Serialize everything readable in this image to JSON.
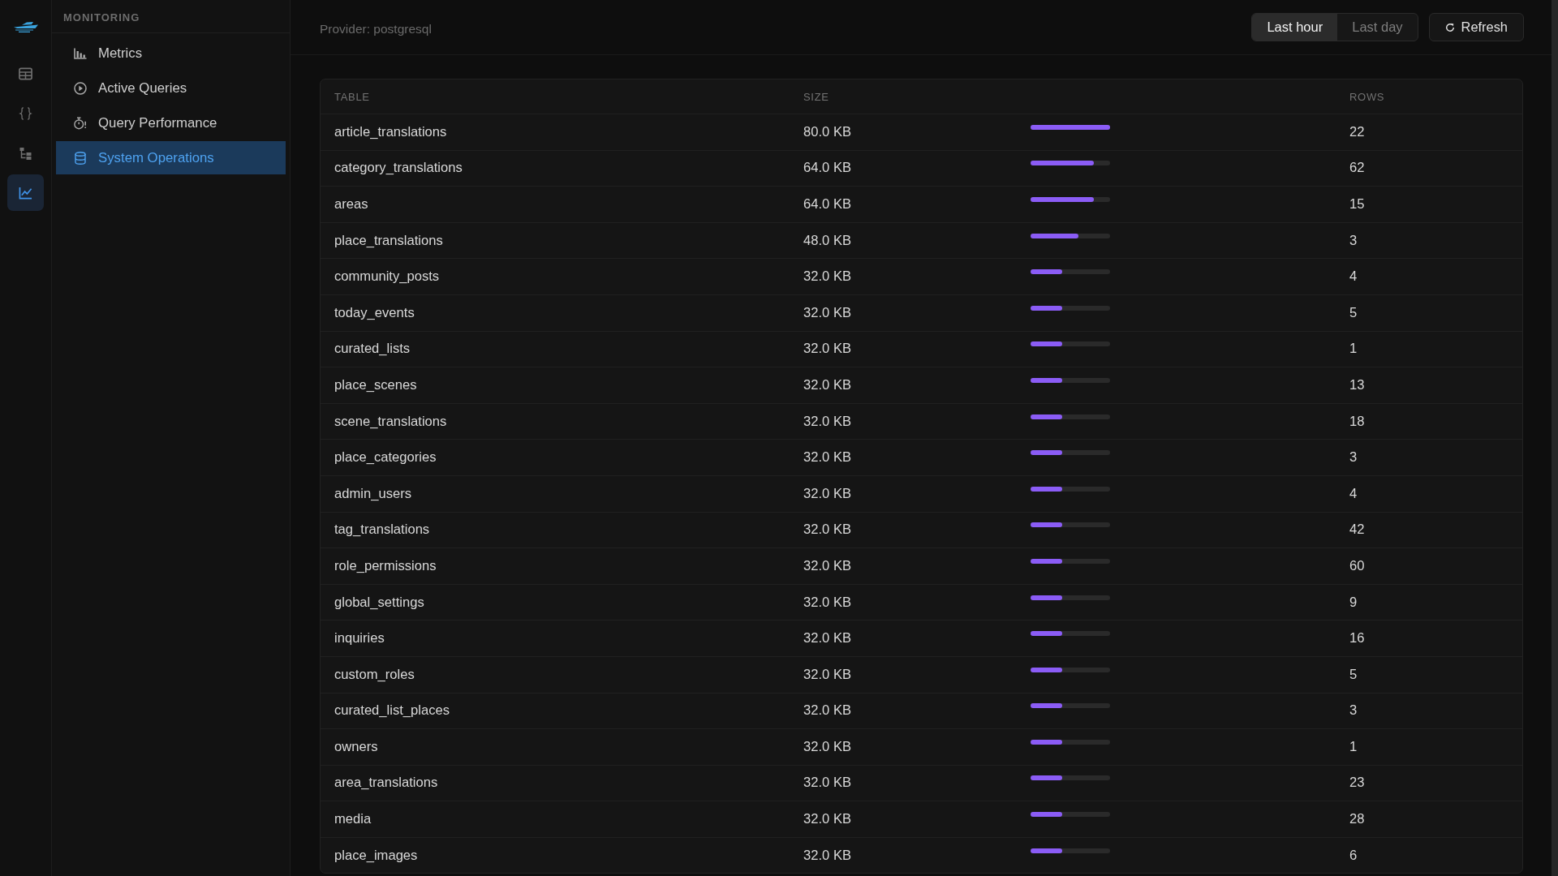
{
  "rail": {
    "items": [
      {
        "selected": false
      },
      {
        "selected": false
      },
      {
        "selected": false
      },
      {
        "selected": true
      }
    ]
  },
  "sidebar": {
    "heading": "MONITORING",
    "items": [
      {
        "label": "Metrics",
        "selected": false
      },
      {
        "label": "Active Queries",
        "selected": false
      },
      {
        "label": "Query Performance",
        "selected": false
      },
      {
        "label": "System Operations",
        "selected": true
      }
    ]
  },
  "header": {
    "provider": "Provider: postgresql",
    "range_tabs": [
      {
        "label": "Last hour",
        "selected": true
      },
      {
        "label": "Last day",
        "selected": false
      }
    ],
    "refresh_button": "Refresh"
  },
  "table": {
    "columns": [
      {
        "label": "TABLE"
      },
      {
        "label": "SIZE"
      },
      {
        "label": "ROWS"
      }
    ],
    "rows": [
      {
        "name": "article_translations",
        "size": "80.0 KB",
        "level": 1.0,
        "rows": "22"
      },
      {
        "name": "category_translations",
        "size": "64.0 KB",
        "level": 0.8,
        "rows": "62"
      },
      {
        "name": "areas",
        "size": "64.0 KB",
        "level": 0.8,
        "rows": "15"
      },
      {
        "name": "place_translations",
        "size": "48.0 KB",
        "level": 0.6,
        "rows": "3"
      },
      {
        "name": "community_posts",
        "size": "32.0 KB",
        "level": 0.4,
        "rows": "4"
      },
      {
        "name": "today_events",
        "size": "32.0 KB",
        "level": 0.4,
        "rows": "5"
      },
      {
        "name": "curated_lists",
        "size": "32.0 KB",
        "level": 0.4,
        "rows": "1"
      },
      {
        "name": "place_scenes",
        "size": "32.0 KB",
        "level": 0.4,
        "rows": "13"
      },
      {
        "name": "scene_translations",
        "size": "32.0 KB",
        "level": 0.4,
        "rows": "18"
      },
      {
        "name": "place_categories",
        "size": "32.0 KB",
        "level": 0.4,
        "rows": "3"
      },
      {
        "name": "admin_users",
        "size": "32.0 KB",
        "level": 0.4,
        "rows": "4"
      },
      {
        "name": "tag_translations",
        "size": "32.0 KB",
        "level": 0.4,
        "rows": "42"
      },
      {
        "name": "role_permissions",
        "size": "32.0 KB",
        "level": 0.4,
        "rows": "60"
      },
      {
        "name": "global_settings",
        "size": "32.0 KB",
        "level": 0.4,
        "rows": "9"
      },
      {
        "name": "inquiries",
        "size": "32.0 KB",
        "level": 0.4,
        "rows": "16"
      },
      {
        "name": "custom_roles",
        "size": "32.0 KB",
        "level": 0.4,
        "rows": "5"
      },
      {
        "name": "curated_list_places",
        "size": "32.0 KB",
        "level": 0.4,
        "rows": "3"
      },
      {
        "name": "owners",
        "size": "32.0 KB",
        "level": 0.4,
        "rows": "1"
      },
      {
        "name": "area_translations",
        "size": "32.0 KB",
        "level": 0.4,
        "rows": "23"
      },
      {
        "name": "media",
        "size": "32.0 KB",
        "level": 0.4,
        "rows": "28"
      },
      {
        "name": "place_images",
        "size": "32.0 KB",
        "level": 0.4,
        "rows": "6"
      }
    ]
  }
}
